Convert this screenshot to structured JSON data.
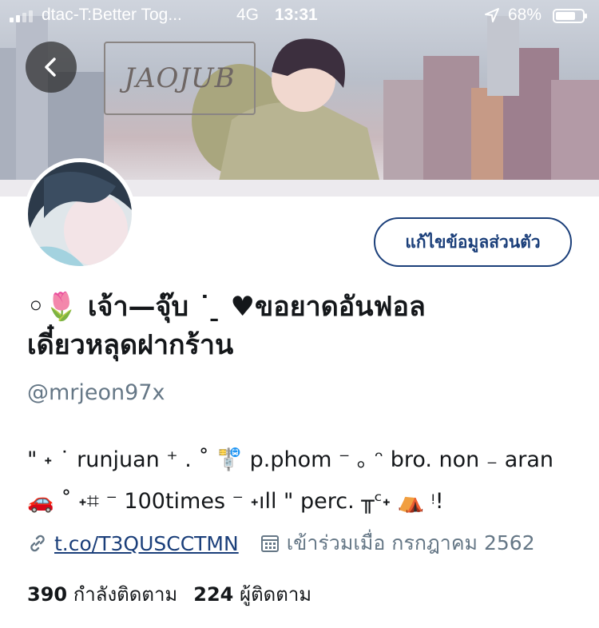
{
  "status_bar": {
    "carrier": "dtac-T:Better Tog...",
    "network": "4G",
    "time": "13:31",
    "battery": "68%"
  },
  "banner": {
    "logo_text": "JAOJUB"
  },
  "profile": {
    "edit_button": "แก้ไขข้อมูลส่วนตัว",
    "display_name_line1": "◦🌷 เจ้า—จุ๊บ ˙ ̠ ♥ขอยาดอันฟอล",
    "display_name_line2": "เดี๋ยวหลุดฝากร้าน",
    "handle": "@mrjeon97x",
    "bio_line1": "\" ˖ ˙ runjuan ⁺ . ˚ 🚏 p.phom ⁻ ｡ ᵔ bro. non ₋ aran",
    "bio_line2": "🚗 ˚ ˖⌗ ⁻ 100times ⁻ ˖ıll \" perc. ╥ᶜ˖ ⛺ ᵎ!",
    "link": "t.co/T3QUSCCTMN",
    "joined": "เข้าร่วมเมื่อ กรกฎาคม 2562",
    "following_count": "390",
    "following_label": "กำลังติดตาม",
    "followers_count": "224",
    "followers_label": "ผู้ติดตาม"
  },
  "icons": {
    "back": "back-arrow-icon",
    "link": "link-icon",
    "calendar": "calendar-icon",
    "location": "location-arrow-icon"
  },
  "colors": {
    "accent": "#1b3f7a",
    "secondary_text": "#657786"
  }
}
